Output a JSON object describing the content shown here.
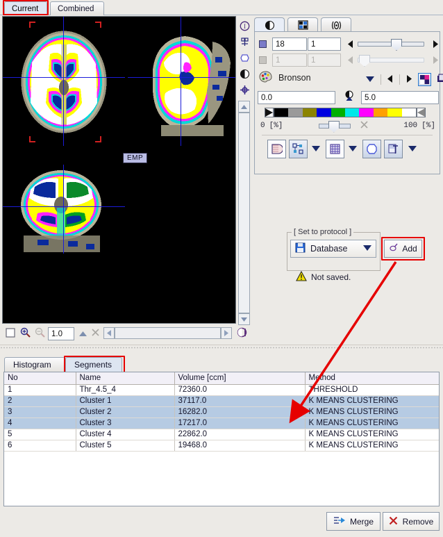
{
  "top_tabs": [
    {
      "label": "Current",
      "selected": true,
      "highlighted": true
    },
    {
      "label": "Combined",
      "selected": false,
      "highlighted": false
    }
  ],
  "viewport": {
    "overlay_label": "EMP",
    "crosshair_color": "#1b1bd8",
    "corner_marker_color": "#d02020",
    "background": "#000000"
  },
  "left_tools": [
    {
      "icon": "info-circle-icon"
    },
    {
      "icon": "probe-tool-icon"
    },
    {
      "icon": "polygon-vgi-icon"
    },
    {
      "icon": "contrast-icon"
    },
    {
      "icon": "crosshair-icon"
    }
  ],
  "image_toolbar": {
    "zoom_value": "1.0",
    "icons": [
      "fit-window-icon",
      "zoom-in-icon",
      "zoom-out-icon",
      "collapse-icon",
      "close-icon",
      "cine-icon"
    ]
  },
  "right_panel": {
    "tabs": [
      {
        "icon": "contrast-icon",
        "selected": true
      },
      {
        "icon": "layout-grid-icon",
        "selected": false
      },
      {
        "icon": "fusion-wave-icon",
        "selected": false
      }
    ],
    "slice_row": {
      "enabled": true,
      "swatch_color": "#7b7bc8",
      "index_value": "18",
      "step_value": "1",
      "slider_percent": 55
    },
    "second_row": {
      "enabled": false,
      "index_value": "1",
      "step_value": "1",
      "slider_percent": 3
    },
    "palette": {
      "icon": "palette-icon",
      "name": "Bronson",
      "dropdown_icon": "chevron-down-icon",
      "prev_icon": "prev-arrow-icon",
      "next_icon": "next-arrow-icon",
      "invert_icon": "invert-palette-icon",
      "copy_icon": "copy-palette-icon",
      "menu_icon": "chevron-down-icon"
    },
    "threshold": {
      "min_value": "0.0",
      "max_value": "5.0",
      "contrast_icon": "contrast-drop-icon"
    },
    "color_bar": {
      "colors": [
        "#000000",
        "#9a9a9a",
        "#8c8400",
        "#0000e0",
        "#00b000",
        "#00e8e8",
        "#ff00ff",
        "#ffa000",
        "#ffff00",
        "#ffffff"
      ]
    },
    "percent_scale": {
      "min_label": "0",
      "min_unit": "[%]",
      "max_label": "100",
      "max_unit": "[%]",
      "reset_icon": "close-x-icon",
      "slider_percent": 50
    },
    "action_buttons": [
      {
        "icon": "threshold-shape-icon",
        "active": false
      },
      {
        "icon": "cluster-icon",
        "active": true
      },
      {
        "icon": "chevron-down-icon",
        "active": false,
        "is_menu": true
      },
      {
        "icon": "grid-mask-icon",
        "active": false
      },
      {
        "icon": "chevron-down-icon",
        "active": false,
        "is_menu": true
      },
      {
        "icon": "contour-icon",
        "active": true
      },
      {
        "icon": "annotate-icon",
        "active": true
      },
      {
        "icon": "chevron-down-icon",
        "active": false,
        "is_menu": true
      }
    ]
  },
  "protocol": {
    "group_title": "[ Set to protocol ]",
    "combo": {
      "icon": "database-save-icon",
      "label": "Database",
      "dropdown_icon": "chevron-down-icon"
    },
    "status": {
      "icon": "warning-icon",
      "text": "Not saved."
    },
    "add_button": {
      "icon": "add-protocol-icon",
      "label": "Add",
      "highlighted": true
    }
  },
  "bottom_tabs": [
    {
      "label": "Histogram",
      "selected": false,
      "highlighted": false
    },
    {
      "label": "Segments",
      "selected": true,
      "highlighted": true
    }
  ],
  "segments_table": {
    "columns": [
      "No",
      "Name",
      "Volume [ccm]",
      "Method"
    ],
    "rows": [
      {
        "no": "1",
        "name": "Thr_4.5_4",
        "volume": "72360.0",
        "method": "THRESHOLD",
        "selected": false
      },
      {
        "no": "2",
        "name": "Cluster 1",
        "volume": "37117.0",
        "method": "K MEANS CLUSTERING",
        "selected": true
      },
      {
        "no": "3",
        "name": "Cluster 2",
        "volume": "16282.0",
        "method": "K MEANS CLUSTERING",
        "selected": true
      },
      {
        "no": "4",
        "name": "Cluster 3",
        "volume": "17217.0",
        "method": "K MEANS CLUSTERING",
        "selected": true
      },
      {
        "no": "5",
        "name": "Cluster 4",
        "volume": "22862.0",
        "method": "K MEANS CLUSTERING",
        "selected": false
      },
      {
        "no": "6",
        "name": "Cluster 5",
        "volume": "19468.0",
        "method": "K MEANS CLUSTERING",
        "selected": false
      }
    ]
  },
  "bottom_buttons": [
    {
      "label": "Merge",
      "icon": "merge-icon"
    },
    {
      "label": "Remove",
      "icon": "remove-x-icon"
    }
  ],
  "annotation": {
    "arrow_color": "#e60000",
    "description": "red arrow from Add button to selected cluster rows"
  }
}
